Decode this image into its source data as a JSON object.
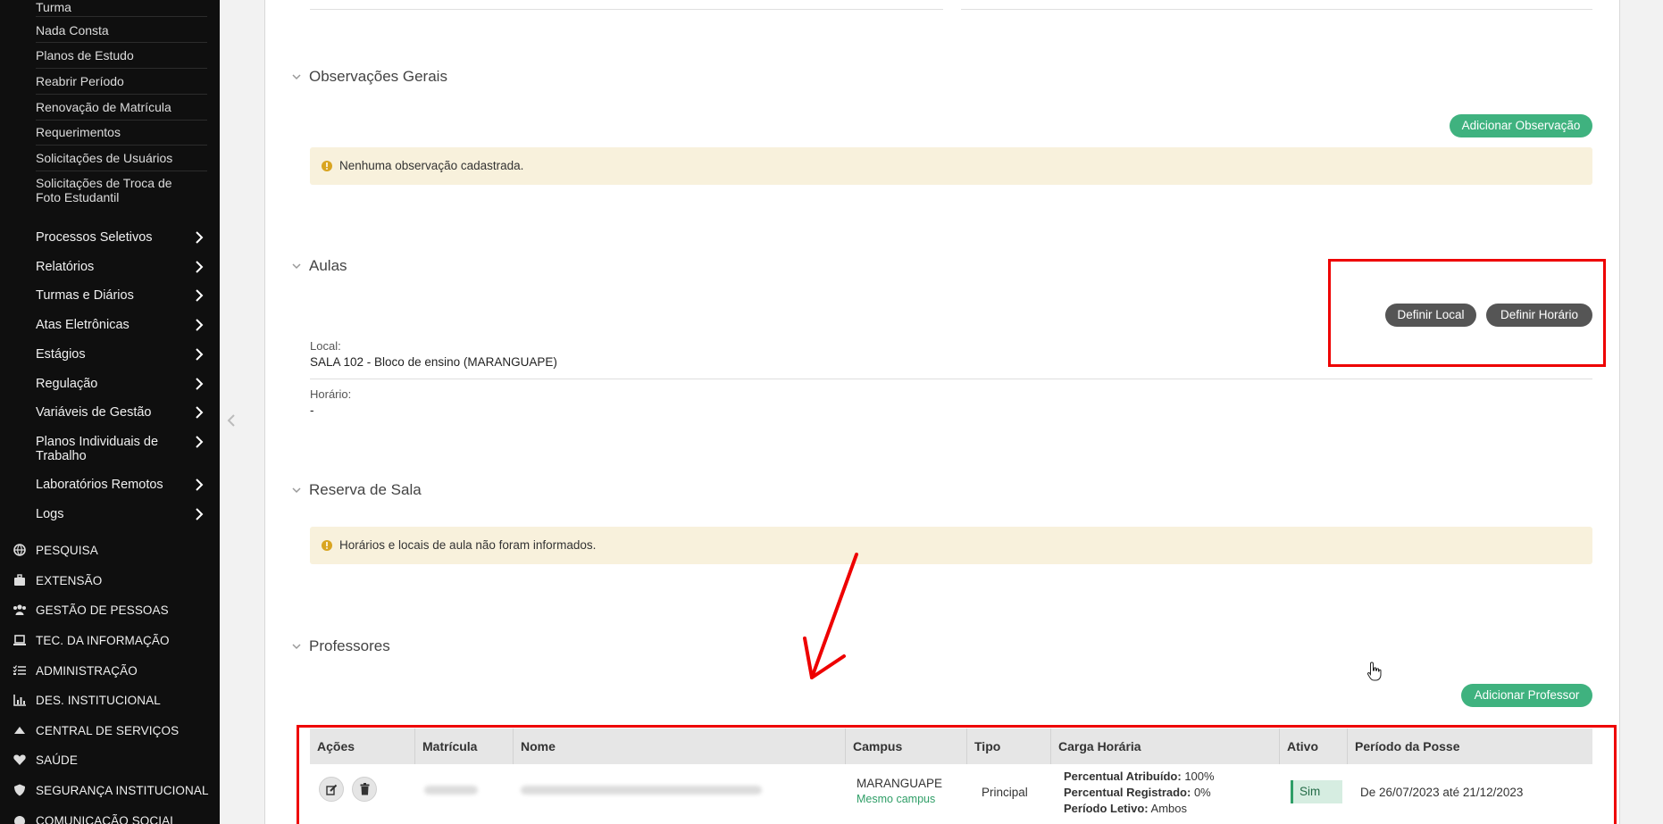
{
  "sidebar": {
    "sub_items": [
      "Turma",
      "Nada Consta",
      "Planos de Estudo",
      "Reabrir Período",
      "Renovação de Matrícula",
      "Requerimentos",
      "Solicitações de Usuários",
      "Solicitações de Troca de Foto Estudantil"
    ],
    "menu_items": [
      "Processos Seletivos",
      "Relatórios",
      "Turmas e Diários",
      "Atas Eletrônicas",
      "Estágios",
      "Regulação",
      "Variáveis de Gestão",
      "Planos Individuais de Trabalho",
      "Laboratórios Remotos",
      "Logs"
    ],
    "sections": [
      {
        "label": "PESQUISA",
        "icon": "globe-icon"
      },
      {
        "label": "EXTENSÃO",
        "icon": "briefcase-icon"
      },
      {
        "label": "GESTÃO DE PESSOAS",
        "icon": "users-icon"
      },
      {
        "label": "TEC. DA INFORMAÇÃO",
        "icon": "laptop-icon"
      },
      {
        "label": "ADMINISTRAÇÃO",
        "icon": "list-icon"
      },
      {
        "label": "DES. INSTITUCIONAL",
        "icon": "chart-icon"
      },
      {
        "label": "CENTRAL DE SERVIÇOS",
        "icon": "cloud-icon"
      },
      {
        "label": "SAÚDE",
        "icon": "heart-icon"
      },
      {
        "label": "SEGURANÇA INSTITUCIONAL",
        "icon": "shield-icon"
      },
      {
        "label": "COMUNICAÇÃO SOCIAL",
        "icon": "circle-icon"
      }
    ]
  },
  "observacoes": {
    "title": "Observações Gerais",
    "add_button": "Adicionar Observação",
    "empty_message": "Nenhuma observação cadastrada."
  },
  "aulas": {
    "title": "Aulas",
    "btn_local": "Definir Local",
    "btn_horario": "Definir Horário",
    "local_label": "Local:",
    "local_value": "SALA 102 - Bloco de ensino (MARANGUAPE)",
    "horario_label": "Horário:",
    "horario_value": "-"
  },
  "reserva": {
    "title": "Reserva de Sala",
    "message": "Horários e locais de aula não foram informados."
  },
  "professores": {
    "title": "Professores",
    "add_button": "Adicionar Professor",
    "columns": [
      "Ações",
      "Matrícula",
      "Nome",
      "Campus",
      "Tipo",
      "Carga Horária",
      "Ativo",
      "Período da Posse"
    ],
    "row": {
      "campus": "MARANGUAPE",
      "campus_note": "Mesmo campus",
      "tipo": "Principal",
      "carga": [
        {
          "label": "Percentual Atribuído:",
          "value": " 100%"
        },
        {
          "label": "Percentual Registrado:",
          "value": " 0%"
        },
        {
          "label": "Período Letivo:",
          "value": " Ambos"
        }
      ],
      "ativo": "Sim",
      "periodo": "De 26/07/2023 até 21/12/2023"
    }
  },
  "colors": {
    "green": "#3fb27f",
    "dark_button": "#555555",
    "alert_bg": "#f8f1dc",
    "annotation_red": "#ee0000"
  }
}
